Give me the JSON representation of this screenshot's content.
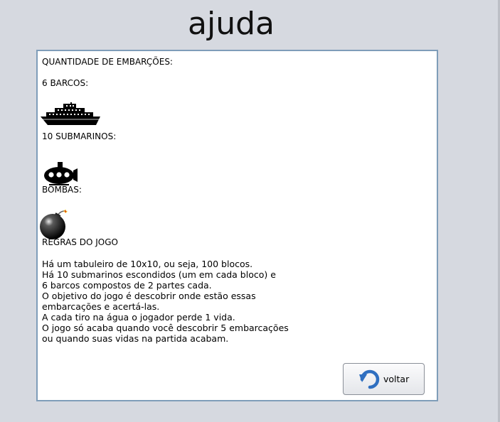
{
  "window": {
    "title": "ajuda"
  },
  "content": {
    "quantity_heading": "QUANTIDADE DE EMBARÇÕES:",
    "boats_label": "6 BARCOS:",
    "submarines_label": "10 SUBMARINOS:",
    "bombs_label": "BOMBAS:",
    "rules_heading": "REGRAS DO JOGO",
    "rules_lines": [
      "Há um tabuleiro de 10x10, ou seja, 100 blocos.",
      "Há 10 submarinos escondidos (um em cada bloco) e",
      "6 barcos compostos de 2 partes cada.",
      "O objetivo do jogo é descobrir onde estão essas",
      "embarcações e acertá-las.",
      "A cada tiro na água o jogador perde 1 vida.",
      "O jogo só acaba quando você descobrir 5 embarcações",
      "ou quando suas vidas na partida acabam."
    ]
  },
  "footer": {
    "back_label": "voltar",
    "back_icon": "undo-arrow-icon"
  },
  "icons": [
    "ship-icon",
    "submarine-icon",
    "bomb-icon"
  ],
  "colors": {
    "background": "#d6d9e0",
    "panel_border": "#7f9db9",
    "button_icon": "#2f6fc0"
  }
}
